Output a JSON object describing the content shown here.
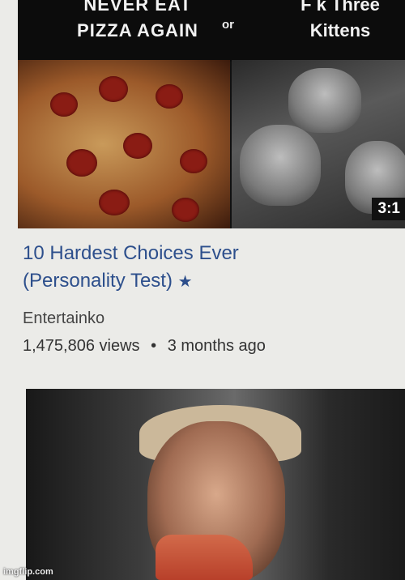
{
  "video1": {
    "thumbnail": {
      "left_caption_line1": "NEVER EAT",
      "left_caption_line2": "PIZZA AGAIN",
      "or_label": "or",
      "right_caption_line1": "F   k Three",
      "right_caption_line2": "Kittens",
      "duration": "3:1"
    },
    "title_line1": "10 Hardest Choices Ever",
    "title_line2": "(Personality Test)",
    "verified_icon": "star-icon",
    "channel": "Entertainko",
    "views": "1,475,806 views",
    "separator": "•",
    "age": "3 months ago"
  },
  "video2": {
    "thumbnail_subject": "man-eating-pizza"
  },
  "watermark": "imgflip.com",
  "colors": {
    "title": "#2d4f8c",
    "background": "#ebebe8"
  }
}
